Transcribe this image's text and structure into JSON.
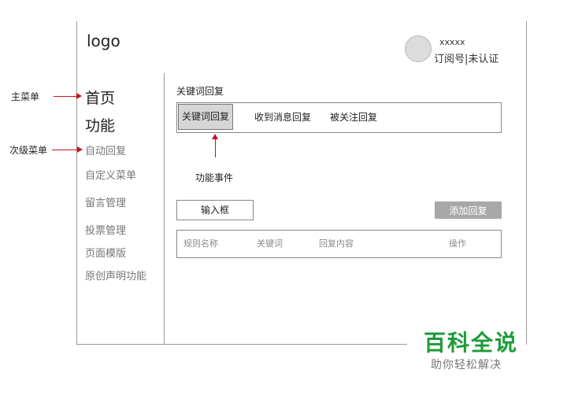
{
  "header": {
    "logo": "logo",
    "account_name": "xxxxx",
    "account_status": "订阅号|未认证"
  },
  "sidebar": {
    "main_items": [
      "首页",
      "功能"
    ],
    "sub_items": [
      "自动回复",
      "自定义菜单",
      "留言管理",
      "投票管理",
      "页面模版",
      "原创声明功能"
    ]
  },
  "annotations": {
    "main_menu": "主菜单",
    "sub_menu": "次级菜单",
    "function_event": "功能事件"
  },
  "main": {
    "section_title": "关键词回复",
    "tabs": [
      {
        "label": "关键词回复",
        "active": true
      },
      {
        "label": "收到消息回复",
        "active": false
      },
      {
        "label": "被关注回复",
        "active": false
      }
    ],
    "input_label": "输入框",
    "add_button": "添加回复",
    "table_headers": [
      "规则名称",
      "关键词",
      "回复内容",
      "操作"
    ]
  },
  "watermark": {
    "title": "百科全说",
    "subtitle": "助你轻松解决"
  },
  "colors": {
    "annotation_arrow": "#c8131d",
    "active_tab_bg": "#d6d6d6",
    "button_bg": "#a8a8a8",
    "watermark": "#1e9b3a"
  }
}
